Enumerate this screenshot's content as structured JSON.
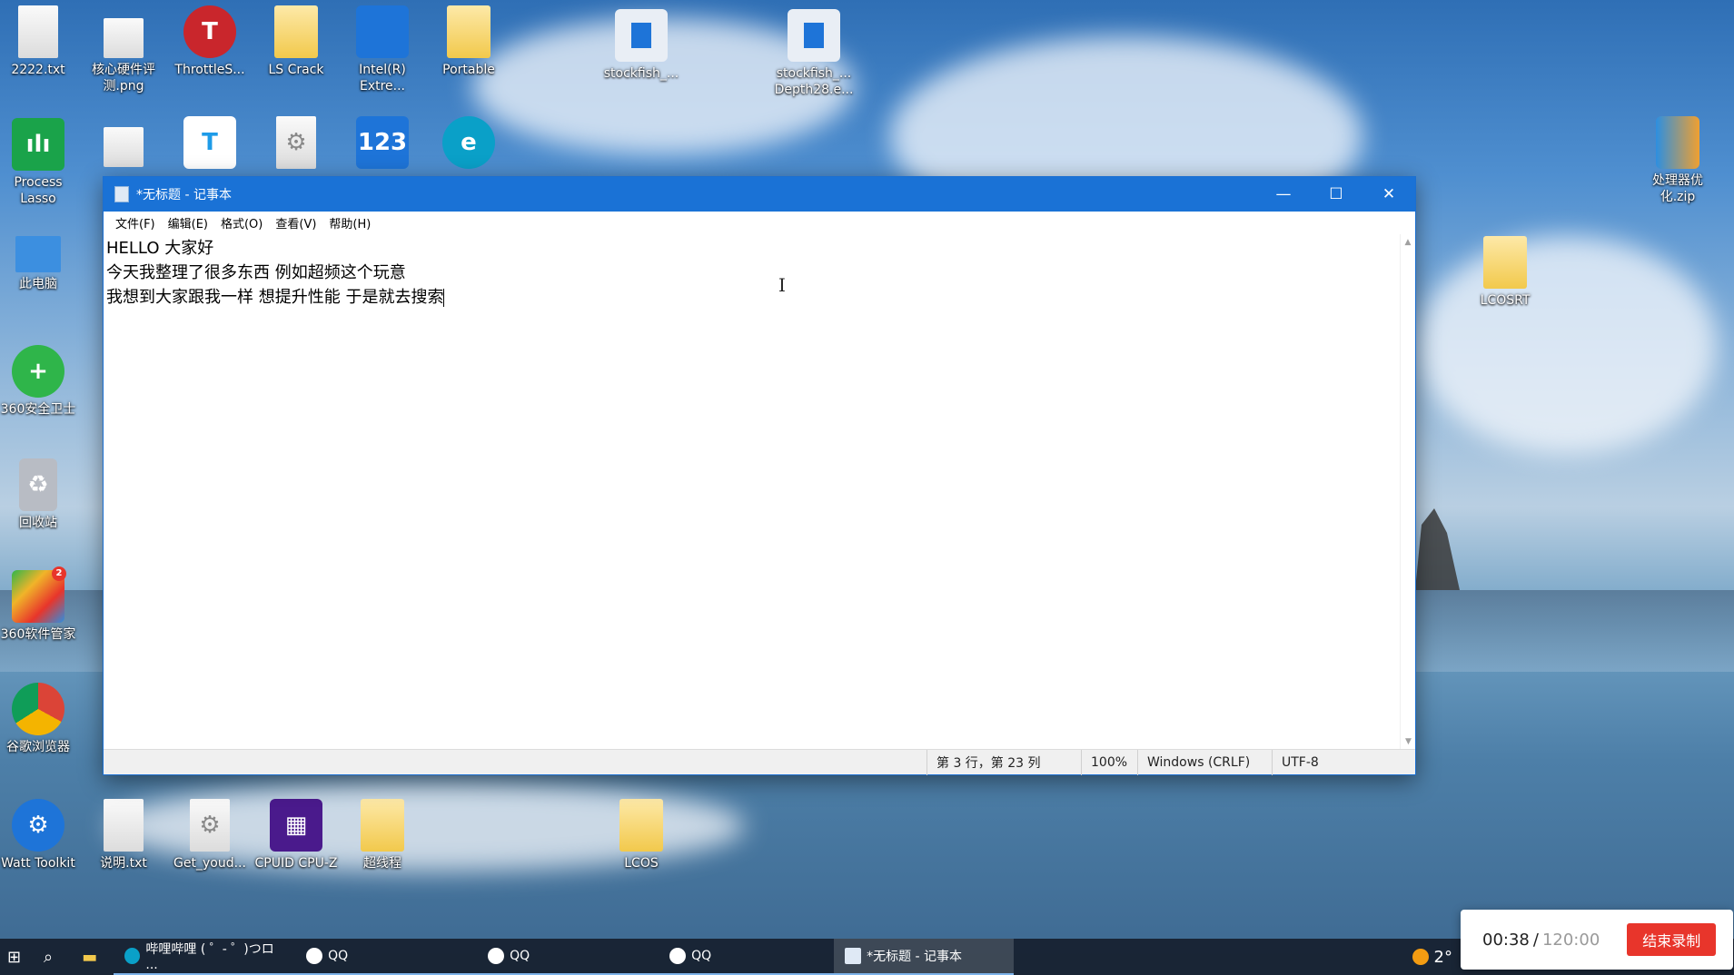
{
  "desktop": {
    "icons_top_row": [
      {
        "label": "2222.txt",
        "icon": "text-file-icon"
      },
      {
        "label": "核心硬件评测.png",
        "icon": "image-file-icon"
      },
      {
        "label": "ThrottleS...",
        "icon": "throttlestop-icon"
      },
      {
        "label": "LS Crack",
        "icon": "folder-icon"
      },
      {
        "label": "Intel(R) Extre...",
        "icon": "intel-xtu-icon"
      },
      {
        "label": "Portable",
        "icon": "folder-icon"
      },
      {
        "label": "stockfish_...",
        "icon": "stockfish-icon"
      },
      {
        "label": "stockfish_... Depth28.e...",
        "icon": "stockfish-icon"
      }
    ],
    "icons_second_row": [
      {
        "label": "Process Lasso",
        "icon": "process-lasso-icon"
      },
      {
        "label": "",
        "icon": "image-file-icon"
      },
      {
        "label": "",
        "icon": "teambition-icon"
      },
      {
        "label": "",
        "icon": "settings-file-icon"
      },
      {
        "label": "",
        "icon": "123pan-icon"
      },
      {
        "label": "",
        "icon": "edge-icon"
      }
    ],
    "icons_left_column": [
      {
        "label": "此电脑",
        "icon": "computer-icon"
      },
      {
        "label": "360安全卫士",
        "icon": "360-security-icon"
      },
      {
        "label": "回收站",
        "icon": "recycle-bin-icon"
      },
      {
        "label": "360软件管家",
        "icon": "360-software-manager-icon",
        "badge": "2"
      },
      {
        "label": "谷歌浏览器",
        "icon": "chrome-icon"
      }
    ],
    "icons_bottom_row": [
      {
        "label": "Watt Toolkit",
        "icon": "watt-toolkit-icon"
      },
      {
        "label": "说明.txt",
        "icon": "text-file-icon"
      },
      {
        "label": "Get_youd...",
        "icon": "settings-file-icon"
      },
      {
        "label": "CPUID CPU-Z",
        "icon": "cpuz-icon"
      },
      {
        "label": "超线程",
        "icon": "folder-icon"
      },
      {
        "label": "LCOS",
        "icon": "folder-icon"
      }
    ],
    "icons_right": [
      {
        "label": "处理器优化.zip",
        "icon": "zip-archive-icon"
      },
      {
        "label": "LCOSRT",
        "icon": "folder-icon"
      }
    ]
  },
  "notepad": {
    "title": "*无标题 - 记事本",
    "window_controls": {
      "minimize": "—",
      "maximize": "☐",
      "close": "✕"
    },
    "menu": [
      "文件(F)",
      "编辑(E)",
      "格式(O)",
      "查看(V)",
      "帮助(H)"
    ],
    "lines": [
      "HELLO 大家好",
      "今天我整理了很多东西 例如超频这个玩意",
      "我想到大家跟我一样 想提升性能 于是就去搜索"
    ],
    "status": {
      "position": "第 3 行，第 23 列",
      "zoom": "100%",
      "line_ending": "Windows (CRLF)",
      "encoding": "UTF-8"
    }
  },
  "taskbar": {
    "tasks": [
      {
        "label": "哔哩哔哩 ( ゜- ゜)つロ ...",
        "icon": "edge-icon",
        "active": false
      },
      {
        "label": "QQ",
        "icon": "qq-icon",
        "active": false
      },
      {
        "label": "QQ",
        "icon": "qq-icon",
        "active": false
      },
      {
        "label": "QQ",
        "icon": "qq-icon",
        "active": false
      },
      {
        "label": "*无标题 - 记事本",
        "icon": "notepad-icon",
        "active": true
      }
    ],
    "tray_text": "2°"
  },
  "recorder": {
    "elapsed": "00:38",
    "separator": "/",
    "total": "120:00",
    "stop_label": "结束录制"
  },
  "colors": {
    "titlebar": "#1a72d6",
    "stop_button": "#e8352b"
  }
}
